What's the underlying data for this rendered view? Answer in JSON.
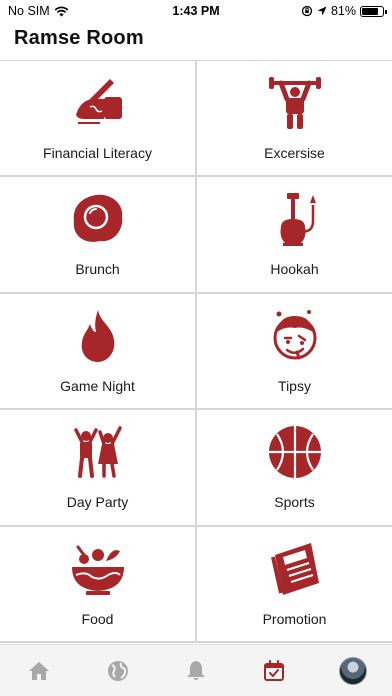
{
  "status_bar": {
    "carrier": "No SIM",
    "time": "1:43 PM",
    "battery_percent": "81%",
    "battery_level": 0.81
  },
  "header": {
    "title": "Ramse Room"
  },
  "categories": [
    {
      "label": "Financial Literacy",
      "icon": "hand-writing-icon"
    },
    {
      "label": "Excersise",
      "icon": "weightlifter-icon"
    },
    {
      "label": "Brunch",
      "icon": "fried-egg-icon"
    },
    {
      "label": "Hookah",
      "icon": "hookah-icon"
    },
    {
      "label": "Game Night",
      "icon": "flame-icon"
    },
    {
      "label": "Tipsy",
      "icon": "tipsy-face-icon"
    },
    {
      "label": "Day Party",
      "icon": "dancing-people-icon"
    },
    {
      "label": "Sports",
      "icon": "basketball-icon"
    },
    {
      "label": "Food",
      "icon": "salad-bowl-icon"
    },
    {
      "label": "Promotion",
      "icon": "newspaper-icon"
    }
  ],
  "tabbar": {
    "tabs": [
      {
        "icon": "home-icon",
        "active": false
      },
      {
        "icon": "globe-icon",
        "active": false
      },
      {
        "icon": "bell-icon",
        "active": false
      },
      {
        "icon": "calendar-icon",
        "active": true
      },
      {
        "icon": "avatar",
        "active": false
      }
    ]
  },
  "colors": {
    "accent": "#a6262a",
    "inactive_icon": "#a8a8a8",
    "divider": "#d6d6d6"
  }
}
